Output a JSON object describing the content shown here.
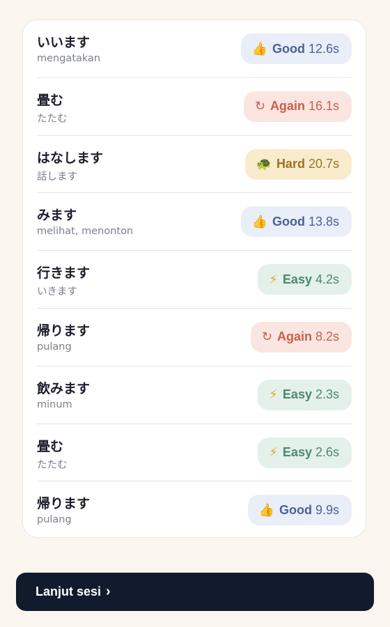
{
  "review_list": [
    {
      "word": "いいます",
      "reading": "mengatakan",
      "rating": "Good",
      "rating_class": "good",
      "icon": "thumbs-up-icon",
      "glyph": "👍",
      "time": "12.6s"
    },
    {
      "word": "畳む",
      "reading": "たたむ",
      "rating": "Again",
      "rating_class": "again",
      "icon": "refresh-icon",
      "glyph": "↻",
      "time": "16.1s"
    },
    {
      "word": "はなします",
      "reading": "話します",
      "rating": "Hard",
      "rating_class": "hard",
      "icon": "turtle-icon",
      "glyph": "🐢",
      "time": "20.7s"
    },
    {
      "word": "みます",
      "reading": "melihat, menonton",
      "rating": "Good",
      "rating_class": "good",
      "icon": "thumbs-up-icon",
      "glyph": "👍",
      "time": "13.8s"
    },
    {
      "word": "行きます",
      "reading": "いきます",
      "rating": "Easy",
      "rating_class": "easy",
      "icon": "lightning-icon",
      "glyph": "⚡",
      "time": "4.2s"
    },
    {
      "word": "帰ります",
      "reading": "pulang",
      "rating": "Again",
      "rating_class": "again",
      "icon": "refresh-icon",
      "glyph": "↻",
      "time": "8.2s"
    },
    {
      "word": "飲みます",
      "reading": "minum",
      "rating": "Easy",
      "rating_class": "easy",
      "icon": "lightning-icon",
      "glyph": "⚡",
      "time": "2.3s"
    },
    {
      "word": "畳む",
      "reading": "たたむ",
      "rating": "Easy",
      "rating_class": "easy",
      "icon": "lightning-icon",
      "glyph": "⚡",
      "time": "2.6s"
    },
    {
      "word": "帰ります",
      "reading": "pulang",
      "rating": "Good",
      "rating_class": "good",
      "icon": "thumbs-up-icon",
      "glyph": "👍",
      "time": "9.9s"
    }
  ],
  "continue_button": {
    "label": "Lanjut sesi",
    "chevron": "›"
  },
  "colors": {
    "background": "#faf6ef",
    "button": "#121a2e",
    "good": "#4a6393",
    "again": "#c8604e",
    "hard": "#9a7420",
    "easy": "#4a8a6e"
  }
}
